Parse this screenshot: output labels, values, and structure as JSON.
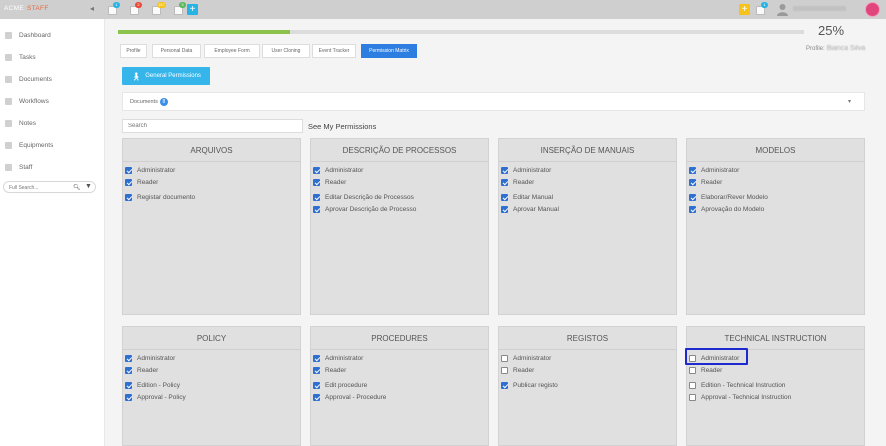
{
  "topbar": {
    "brand_a": "ACME",
    "brand_b": "STAFF",
    "notifications": [
      {
        "icon": "document-icon",
        "count": "1",
        "color": "#27b3e4"
      },
      {
        "icon": "document-icon",
        "count": "2",
        "color": "#e9493b"
      },
      {
        "icon": "document-icon",
        "count": "157",
        "color": "#f6c21c"
      },
      {
        "icon": "document-icon",
        "count": "3",
        "color": "#5cb85c"
      }
    ],
    "add_icon": "plus-icon",
    "yellow_add_icon": "plus-icon",
    "message_badge": "1",
    "user_icon": "user-icon"
  },
  "sidebar": {
    "items": [
      {
        "label": "Dashboard",
        "icon": "home-icon"
      },
      {
        "label": "Tasks",
        "icon": "gear-icon"
      },
      {
        "label": "Documents",
        "icon": "document-icon"
      },
      {
        "label": "Workflows",
        "icon": "workflow-icon"
      },
      {
        "label": "Notes",
        "icon": "notes-icon"
      },
      {
        "label": "Equipments",
        "icon": "wrench-icon"
      },
      {
        "label": "Staff",
        "icon": "user-icon"
      }
    ],
    "search_placeholder": "Full Search..."
  },
  "progress": {
    "value": "25%",
    "fraction": 0.25,
    "color": "#8bc34a"
  },
  "profile": {
    "label": "Profile:",
    "name": "Bianca Silva"
  },
  "tabs": [
    {
      "label": "Profile",
      "active": false
    },
    {
      "label": "Personal Data",
      "active": false
    },
    {
      "label": "Employee Form",
      "active": false
    },
    {
      "label": "User Cloning",
      "active": false
    },
    {
      "label": "Event Tracker",
      "active": false
    },
    {
      "label": "Permission Matrix",
      "active": true
    }
  ],
  "general_permissions": "General Permissions",
  "documents": {
    "label": "Documents",
    "count": "8"
  },
  "search": {
    "placeholder": "Search",
    "see_my": "See My Permissions"
  },
  "cards": [
    {
      "title": "ARQUIVOS",
      "groups": [
        [
          {
            "label": "Administrator",
            "checked": true
          },
          {
            "label": "Reader",
            "checked": true
          }
        ],
        [
          {
            "label": "Registar documento",
            "checked": true
          }
        ]
      ]
    },
    {
      "title": "DESCRIÇÃO DE PROCESSOS",
      "groups": [
        [
          {
            "label": "Administrator",
            "checked": true
          },
          {
            "label": "Reader",
            "checked": true
          }
        ],
        [
          {
            "label": "Editar Descrição de Processos",
            "checked": true
          },
          {
            "label": "Aprovar Descrição de Processo",
            "checked": true
          }
        ]
      ]
    },
    {
      "title": "INSERÇÃO DE MANUAIS",
      "groups": [
        [
          {
            "label": "Administrator",
            "checked": true
          },
          {
            "label": "Reader",
            "checked": true
          }
        ],
        [
          {
            "label": "Editar Manual",
            "checked": true
          },
          {
            "label": "Aprovar Manual",
            "checked": true
          }
        ]
      ]
    },
    {
      "title": "MODELOS",
      "groups": [
        [
          {
            "label": "Administrator",
            "checked": true
          },
          {
            "label": "Reader",
            "checked": true
          }
        ],
        [
          {
            "label": "Elaborar/Rever Modelo",
            "checked": true
          },
          {
            "label": "Aprovação do Modelo",
            "checked": true
          }
        ]
      ]
    },
    {
      "title": "POLICY",
      "groups": [
        [
          {
            "label": "Administrator",
            "checked": true
          },
          {
            "label": "Reader",
            "checked": true
          }
        ],
        [
          {
            "label": "Edition - Policy",
            "checked": true
          },
          {
            "label": "Approval - Policy",
            "checked": true
          }
        ]
      ]
    },
    {
      "title": "PROCEDURES",
      "groups": [
        [
          {
            "label": "Administrator",
            "checked": true
          },
          {
            "label": "Reader",
            "checked": true
          }
        ],
        [
          {
            "label": "Edit procedure",
            "checked": true
          },
          {
            "label": "Approval - Procedure",
            "checked": true
          }
        ]
      ]
    },
    {
      "title": "REGISTOS",
      "groups": [
        [
          {
            "label": "Administrator",
            "checked": false
          },
          {
            "label": "Reader",
            "checked": false
          }
        ],
        [
          {
            "label": "Publicar registo",
            "checked": true
          }
        ]
      ]
    },
    {
      "title": "TECHNICAL INSTRUCTION",
      "groups": [
        [
          {
            "label": "Administrator",
            "checked": false
          },
          {
            "label": "Reader",
            "checked": false
          }
        ],
        [
          {
            "label": "Edition - Technical Instruction",
            "checked": false
          },
          {
            "label": "Approval - Technical Instruction",
            "checked": false
          }
        ]
      ]
    }
  ]
}
